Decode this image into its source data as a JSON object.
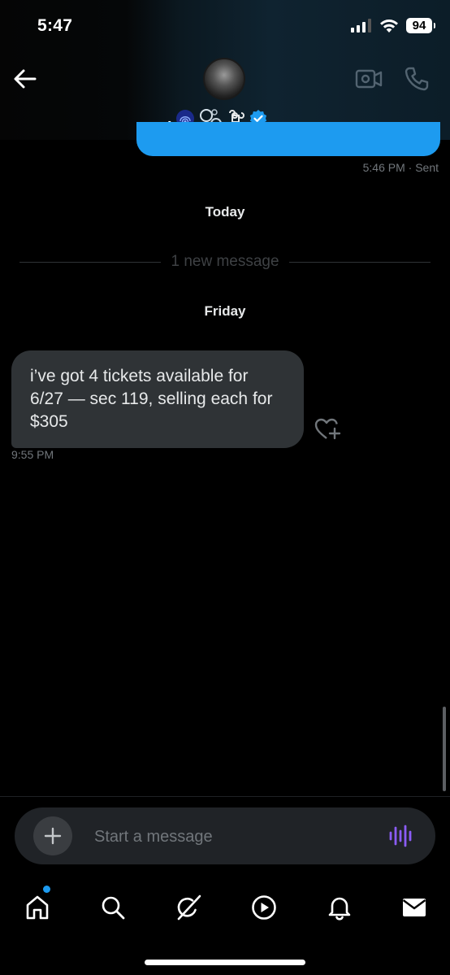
{
  "status_bar": {
    "time": "5:47",
    "battery": "94"
  },
  "header": {
    "display_name_prefix": ".",
    "verified_color": "#1d9bf0",
    "icons": [
      "back-arrow-icon",
      "avatar",
      "video-call-icon",
      "phone-call-icon"
    ]
  },
  "conversation": {
    "sent_meta": "5:46 PM · Sent",
    "today_label": "Today",
    "new_message_divider": "1 new message",
    "friday_label": "Friday",
    "received_message": {
      "text": "i’ve got 4 tickets available for 6/27 — sec 119, selling each for $305",
      "time": "9:55 PM"
    }
  },
  "composer": {
    "placeholder": "Start a message"
  },
  "tab_bar": {
    "items": [
      "home",
      "search",
      "grok",
      "videos",
      "notifications",
      "messages"
    ],
    "accent": "#1d9bf0"
  }
}
